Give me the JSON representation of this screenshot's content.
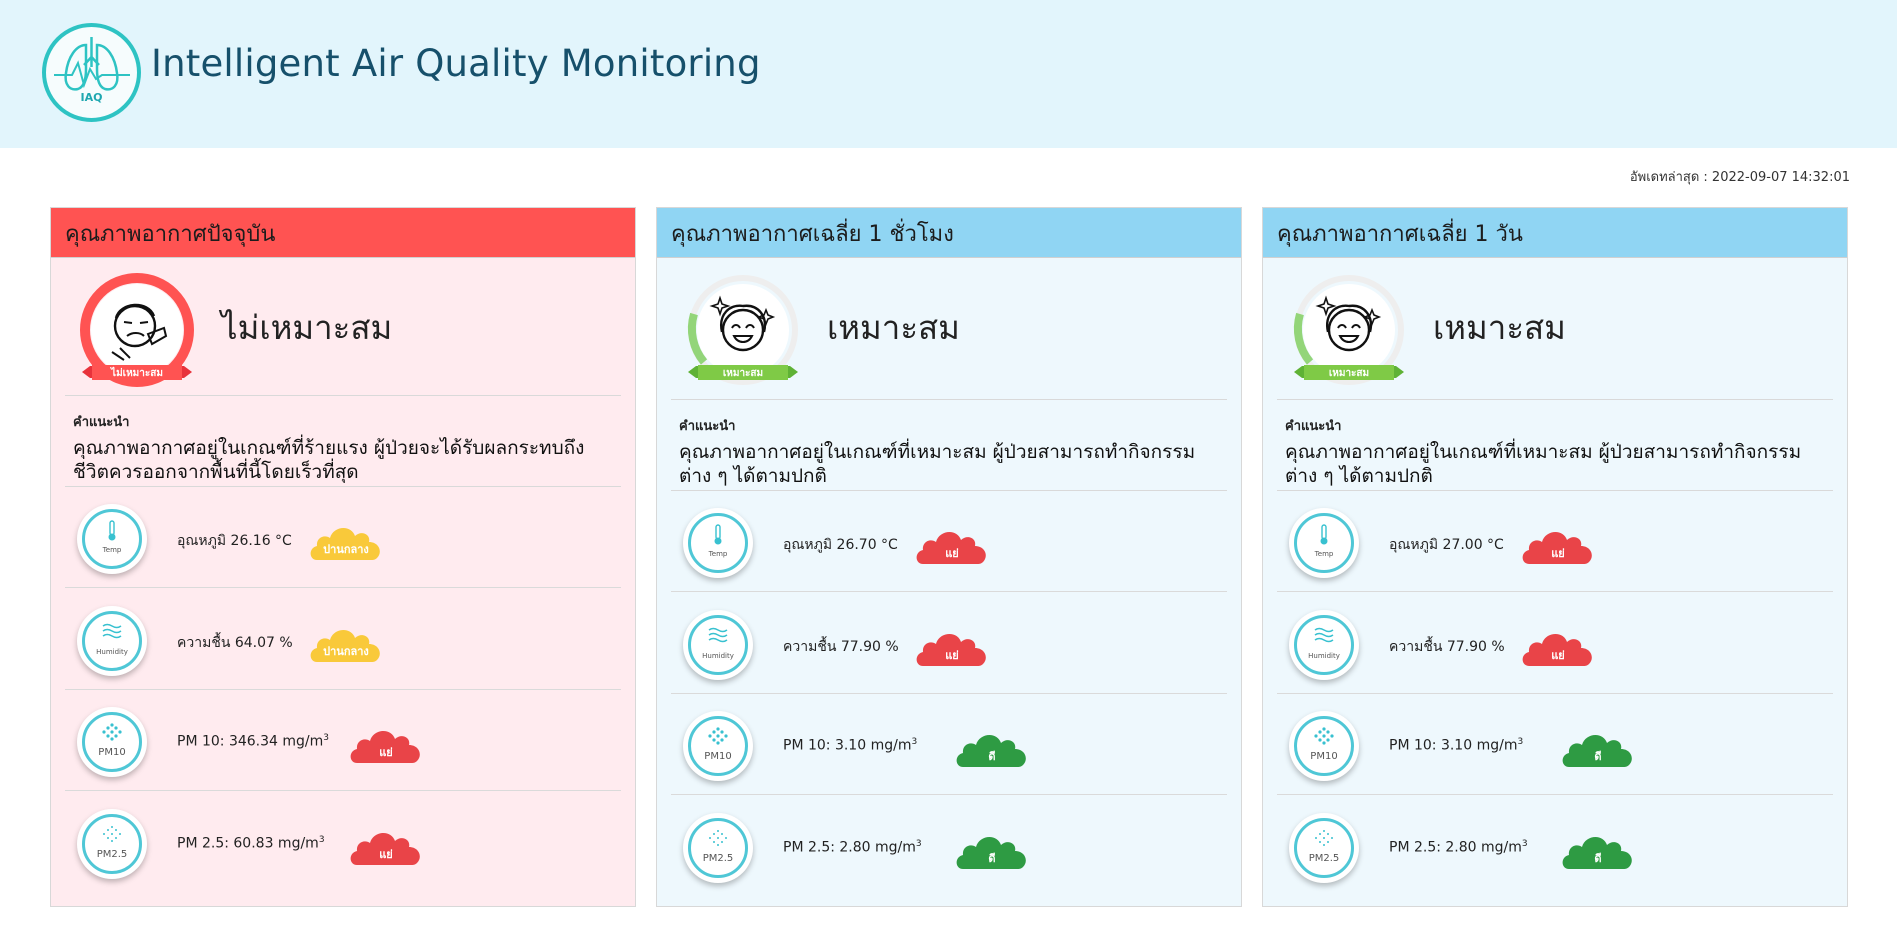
{
  "app": {
    "title": "Intelligent Air Quality Monitoring",
    "logo_text": "IAQ"
  },
  "updated": "อัพเดทล่าสุด : 2022-09-07 14:32:01",
  "colors": {
    "bad": "#e94448",
    "moderate": "#f9c93a",
    "good": "#2e9b43",
    "panel_bad": "#ffebef",
    "panel_good": "#eef8fd",
    "head_bad": "#ff5352",
    "head_good": "#90d5f3"
  },
  "advice_label": "คำแนะนำ",
  "panels": [
    {
      "title": "คุณภาพอากาศปัจจุบัน",
      "status": "ไม่เหมาะสม",
      "status_badge": "ไม่เหมาะสม",
      "status_level": "bad",
      "advice": "คุณภาพอากาศอยู่ในเกณฑ์ที่ร้ายแรง ผู้ป่วยจะได้รับผลกระทบถึงชีวิตควรออกจากพื้นที่นี้โดยเร็วที่สุด",
      "metrics": [
        {
          "icon": "thermometer-icon",
          "gauge_label": "Temp",
          "text": "อุณหภูมิ 26.16 °C",
          "level_label": "ปานกลาง",
          "level": "moderate"
        },
        {
          "icon": "humidity-icon",
          "gauge_label": "Humidity",
          "text": "ความชื้น 64.07 %",
          "level_label": "ปานกลาง",
          "level": "moderate"
        },
        {
          "icon": "pm10-icon",
          "gauge_label": "PM10",
          "text": "PM 10: 346.34 mg/m",
          "level_label": "แย่",
          "level": "bad"
        },
        {
          "icon": "pm25-icon",
          "gauge_label": "PM2.5",
          "text": "PM 2.5: 60.83 mg/m",
          "level_label": "แย่",
          "level": "bad"
        }
      ]
    },
    {
      "title": "คุณภาพอากาศเฉลี่ย 1 ชั่วโมง",
      "status": "เหมาะสม",
      "status_badge": "เหมาะสม",
      "status_level": "good",
      "advice": "คุณภาพอากาศอยู่ในเกณฑ์ที่เหมาะสม ผู้ป่วยสามารถทำกิจกรรมต่าง ๆ ได้ตามปกติ",
      "metrics": [
        {
          "icon": "thermometer-icon",
          "gauge_label": "Temp",
          "text": "อุณหภูมิ 26.70 °C",
          "level_label": "แย่",
          "level": "bad"
        },
        {
          "icon": "humidity-icon",
          "gauge_label": "Humidity",
          "text": "ความชื้น 77.90 %",
          "level_label": "แย่",
          "level": "bad"
        },
        {
          "icon": "pm10-icon",
          "gauge_label": "PM10",
          "text": "PM 10: 3.10 mg/m",
          "level_label": "ดี",
          "level": "good"
        },
        {
          "icon": "pm25-icon",
          "gauge_label": "PM2.5",
          "text": "PM 2.5: 2.80 mg/m",
          "level_label": "ดี",
          "level": "good"
        }
      ]
    },
    {
      "title": "คุณภาพอากาศเฉลี่ย 1 วัน",
      "status": "เหมาะสม",
      "status_badge": "เหมาะสม",
      "status_level": "good",
      "advice": "คุณภาพอากาศอยู่ในเกณฑ์ที่เหมาะสม ผู้ป่วยสามารถทำกิจกรรมต่าง ๆ ได้ตามปกติ",
      "metrics": [
        {
          "icon": "thermometer-icon",
          "gauge_label": "Temp",
          "text": "อุณหภูมิ 27.00 °C",
          "level_label": "แย่",
          "level": "bad"
        },
        {
          "icon": "humidity-icon",
          "gauge_label": "Humidity",
          "text": "ความชื้น 77.90 %",
          "level_label": "แย่",
          "level": "bad"
        },
        {
          "icon": "pm10-icon",
          "gauge_label": "PM10",
          "text": "PM 10: 3.10 mg/m",
          "level_label": "ดี",
          "level": "good"
        },
        {
          "icon": "pm25-icon",
          "gauge_label": "PM2.5",
          "text": "PM 2.5: 2.80 mg/m",
          "level_label": "ดี",
          "level": "good"
        }
      ]
    }
  ]
}
